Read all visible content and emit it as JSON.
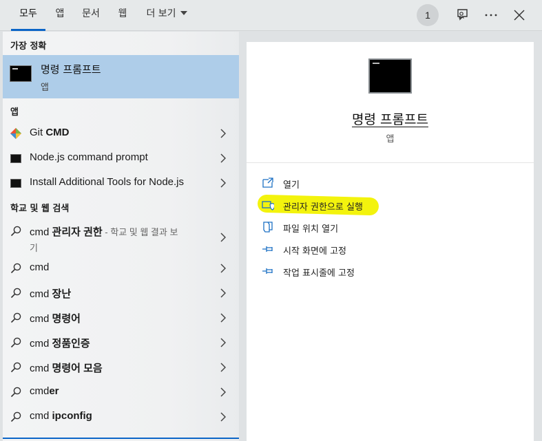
{
  "tabs": [
    {
      "label": "모두",
      "active": true
    },
    {
      "label": "앱",
      "active": false
    },
    {
      "label": "문서",
      "active": false
    },
    {
      "label": "웹",
      "active": false
    },
    {
      "label": "더 보기",
      "active": false
    }
  ],
  "top_right": {
    "badge": "1",
    "icons": [
      "feedback-icon",
      "more-icon",
      "close-icon"
    ]
  },
  "best_match": {
    "section_title": "가장 정확",
    "name": "명령 프롬프트",
    "type": "앱"
  },
  "apps": {
    "section_title": "앱",
    "items": [
      {
        "name": "Git ",
        "bold": "CMD",
        "icon": "git-icon"
      },
      {
        "name": "Node.js command prompt",
        "bold": "",
        "icon": "cmd-icon"
      },
      {
        "name": "Install Additional Tools for Node.js",
        "bold": "",
        "icon": "cmd-icon"
      }
    ]
  },
  "web": {
    "section_title": "학교 및 웹 검색",
    "first": {
      "prefix": "cmd ",
      "bold": "관리자 권한",
      "suffix": " - 학교 및 웹 결과 보",
      "line2": "기"
    },
    "items": [
      {
        "prefix": "cmd",
        "bold": ""
      },
      {
        "prefix": "cmd ",
        "bold": "장난"
      },
      {
        "prefix": "cmd ",
        "bold": "명령어"
      },
      {
        "prefix": "cmd ",
        "bold": "정품인증"
      },
      {
        "prefix": "cmd ",
        "bold": "명령어 모음"
      },
      {
        "prefix": "cmd",
        "bold": "er"
      },
      {
        "prefix": "cmd ",
        "bold": "ipconfig"
      }
    ]
  },
  "detail": {
    "title": "명령 프롬프트",
    "subtitle": "앱",
    "actions": [
      {
        "label": "열기",
        "icon": "open-icon"
      },
      {
        "label": "관리자 권한으로 실행",
        "icon": "shield-icon"
      },
      {
        "label": "파일 위치 열기",
        "icon": "folder-icon"
      },
      {
        "label": "시작 화면에 고정",
        "icon": "pin-icon"
      },
      {
        "label": "작업 표시줄에 고정",
        "icon": "pin-icon"
      }
    ]
  },
  "colors": {
    "accent": "#0a64c7",
    "highlight": "#f2f200",
    "selected": "#aecde9"
  }
}
